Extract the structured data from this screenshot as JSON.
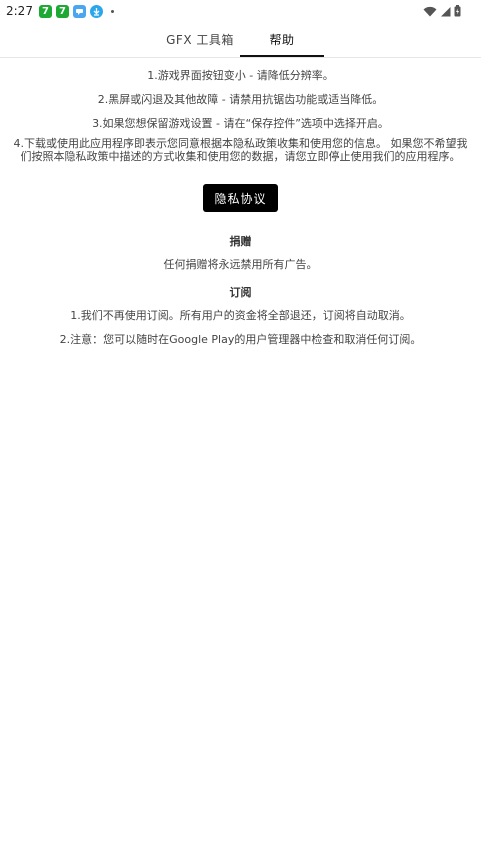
{
  "status_bar": {
    "time": "2:27",
    "icons": [
      "app-7-icon",
      "app-7-icon",
      "chat-app-icon",
      "download-icon",
      "dot-icon",
      "wifi-icon",
      "cell-signal-icon",
      "battery-icon"
    ],
    "app_badge": "7",
    "colors": {
      "green": "#1ea834",
      "blue": "#4aa6f0",
      "cyan": "#2aa7ec"
    }
  },
  "tabs": [
    {
      "label": "GFX 工具箱",
      "selected": false
    },
    {
      "label": "帮助",
      "selected": true
    }
  ],
  "help": {
    "items": [
      "1.游戏界面按钮变小 - 请降低分辨率。",
      "2.黑屏或闪退及其他故障 - 请禁用抗锯齿功能或适当降低。",
      "3.如果您想保留游戏设置 - 请在“保存控件”选项中选择开启。"
    ],
    "item4_line1": "4.下载或使用此应用程序即表示您同意根据本隐私政策收集和使用您的信息。 如果您不希望我",
    "item4_line2": "们按照本隐私政策中描述的方式收集和使用您的数据，请您立即停止使用我们的应用程序。",
    "privacy_button": "隐私协议"
  },
  "donate": {
    "title": "捐赠",
    "text": "任何捐赠将永远禁用所有广告。"
  },
  "subscription": {
    "title": "订阅",
    "items": [
      "1.我们不再使用订阅。所有用户的资金将全部退还，订阅将自动取消。",
      "2.注意：您可以随时在Google Play的用户管理器中检查和取消任何订阅。"
    ]
  }
}
